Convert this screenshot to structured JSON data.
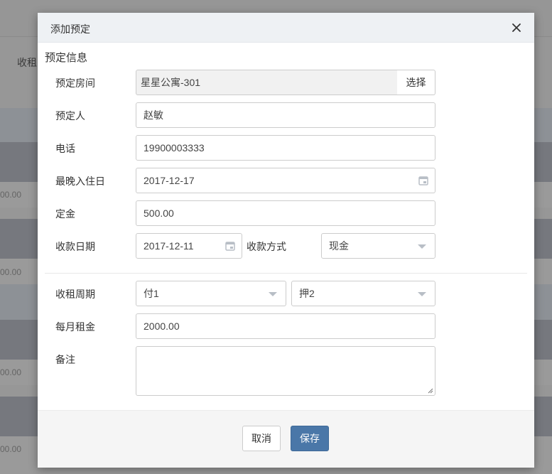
{
  "background": {
    "partial_label": "收租",
    "partial_amounts": [
      "00.00",
      "00.00",
      "00.00",
      "00.00"
    ]
  },
  "modal": {
    "title": "添加预定",
    "section_title": "预定信息",
    "fields": {
      "room": {
        "label": "预定房间",
        "value": "星星公寓-301",
        "button": "选择"
      },
      "booker": {
        "label": "预定人",
        "value": "赵敏"
      },
      "phone": {
        "label": "电话",
        "value": "19900003333"
      },
      "latest_checkin": {
        "label": "最晚入住日",
        "value": "2017-12-17"
      },
      "deposit": {
        "label": "定金",
        "value": "500.00"
      },
      "payment_date": {
        "label": "收款日期",
        "value": "2017-12-11"
      },
      "payment_method": {
        "label": "收款方式",
        "value": "现金"
      },
      "rent_cycle": {
        "label": "收租周期",
        "pay_value": "付1",
        "deposit_value": "押2"
      },
      "monthly_rent": {
        "label": "每月租金",
        "value": "2000.00"
      },
      "notes": {
        "label": "备注",
        "value": ""
      }
    },
    "footer": {
      "cancel_label": "取消",
      "save_label": "保存"
    }
  },
  "colors": {
    "primary": "#4a77a8",
    "header_bg": "#eef1f4",
    "border": "#cccccc"
  }
}
